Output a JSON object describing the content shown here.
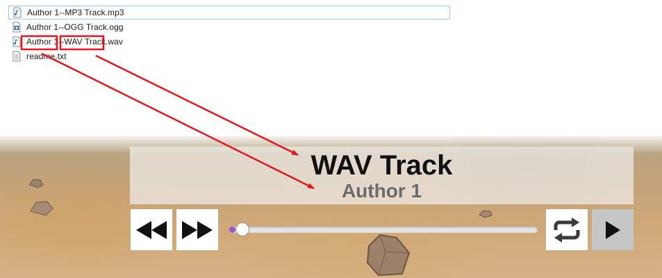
{
  "explorer": {
    "files": [
      {
        "name": "Author 1--MP3 Track.mp3",
        "icon": "audio-file-icon",
        "selected": true
      },
      {
        "name": "Author 1--OGG Track.ogg",
        "icon": "media-file-icon",
        "selected": false
      },
      {
        "name": "Author 1--WAV Track.wav",
        "icon": "audio-file-icon",
        "selected": false
      },
      {
        "name": "readme.txt",
        "icon": "text-file-icon",
        "selected": false
      }
    ]
  },
  "player": {
    "title": "WAV Track",
    "author": "Author 1",
    "progress": 0.02,
    "buttons": {
      "rewind": "rewind-icon",
      "forward": "fast-forward-icon",
      "repeat": "repeat-icon",
      "play": "play-icon"
    },
    "colors": {
      "progress_fill": "#9b59d0",
      "annotation": "#e8141b",
      "play_button_bg": "#c6c6c6"
    }
  }
}
